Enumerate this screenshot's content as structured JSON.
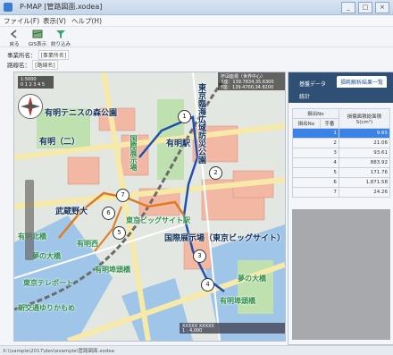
{
  "window": {
    "title": "P-MAP [管路図面.xodea]",
    "min": "_",
    "max": "□",
    "close": "×"
  },
  "menu": [
    "ファイル(F)",
    "表示(V)",
    "ヘルプ(H)"
  ],
  "toolbar": [
    {
      "label": "戻る",
      "icon": "back-icon"
    },
    {
      "label": "GIS表示",
      "icon": "map-icon"
    },
    {
      "label": "絞り込み",
      "icon": "filter-icon"
    }
  ],
  "info": {
    "row1_label": "事業所名：",
    "row1_value": "[事業所名]",
    "row2_label": "路線名：",
    "row2_value": "[路線名]"
  },
  "map": {
    "labels": [
      {
        "text": "有明テニスの森公園",
        "cls": ""
      },
      {
        "text": "有明（二）",
        "cls": ""
      },
      {
        "text": "有明駅",
        "cls": ""
      },
      {
        "text": "東京臨海広域防災公園",
        "cls": "vert"
      },
      {
        "text": "武蔵野大",
        "cls": ""
      },
      {
        "text": "東京ビッグサイト駅",
        "cls": "green"
      },
      {
        "text": "国際展示場（東京ビッグサイト）",
        "cls": ""
      },
      {
        "text": "有明埠頭橋",
        "cls": "green"
      },
      {
        "text": "新交通ゆりかもめ",
        "cls": "green"
      },
      {
        "text": "夢の大橋",
        "cls": "green"
      },
      {
        "text": "有明北橋",
        "cls": "green"
      },
      {
        "text": "国際展示場",
        "cls": "green vert"
      },
      {
        "text": "東京テレポート",
        "cls": "green"
      },
      {
        "text": "有明西",
        "cls": "green"
      },
      {
        "text": "夢の大橋",
        "cls": "green"
      },
      {
        "text": "有明埠頭橋",
        "cls": "green"
      }
    ],
    "markers": [
      "1",
      "2",
      "3",
      "4",
      "5",
      "6",
      "7"
    ],
    "corner_info": {
      "line1": "地図座標（世界中心）",
      "line2": "X座：139.7834,35.6300",
      "line3": "Y座：139.4700,34.8200"
    },
    "scale_info": {
      "line1": "1:5000",
      "line2": "0 1 2 3 4 5"
    },
    "status": {
      "line1": "XXXXX XXXXX",
      "line2": "1 : 4,000"
    }
  },
  "panel": {
    "tabs": [
      {
        "label": "基盤データ",
        "active": false
      },
      {
        "label": "損耗解析結果一覧",
        "active": true
      }
    ],
    "subtab": "統計",
    "headers": {
      "col1": "損出No",
      "col1a": "損出No",
      "col1b": "手番",
      "col2": "損傷面積総面積",
      "col2b": "S(cm²)"
    },
    "rows": [
      {
        "no": "1",
        "value": "9.65",
        "selected": true
      },
      {
        "no": "2",
        "value": "21.06",
        "selected": false
      },
      {
        "no": "3",
        "value": "93.61",
        "selected": false
      },
      {
        "no": "4",
        "value": "883.92",
        "selected": false
      },
      {
        "no": "5",
        "value": "171.76",
        "selected": false
      },
      {
        "no": "6",
        "value": "1,871.58",
        "selected": false
      },
      {
        "no": "7",
        "value": "24.26",
        "selected": false
      }
    ]
  },
  "status_bar": {
    "path": "X:\\\\sample\\2017\\dev\\example\\管路図面.xodea"
  },
  "colors": {
    "route_blue": "#1f4fb0",
    "route_orange": "#e07a1c",
    "accent": "#3b82e6",
    "panel_header": "#2f4f75"
  }
}
